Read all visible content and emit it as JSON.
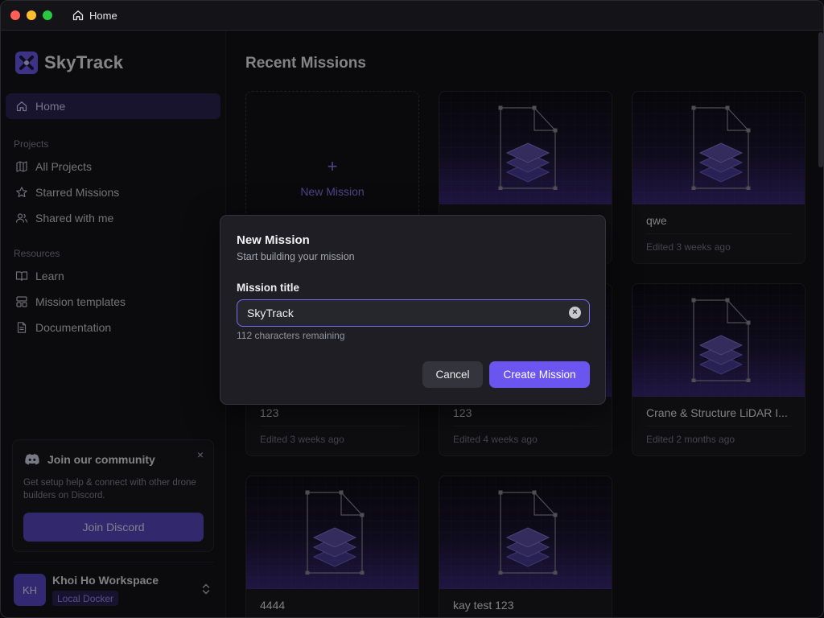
{
  "titlebar": {
    "tab_label": "Home"
  },
  "sidebar": {
    "app_name": "SkyTrack",
    "home_label": "Home",
    "projects_heading": "Projects",
    "projects_items": [
      {
        "label": "All Projects",
        "icon": "map-icon"
      },
      {
        "label": "Starred Missions",
        "icon": "star-icon"
      },
      {
        "label": "Shared with me",
        "icon": "users-icon"
      }
    ],
    "resources_heading": "Resources",
    "resources_items": [
      {
        "label": "Learn",
        "icon": "book-icon"
      },
      {
        "label": "Mission templates",
        "icon": "templates-icon"
      },
      {
        "label": "Documentation",
        "icon": "document-icon"
      }
    ],
    "community": {
      "title": "Join our community",
      "text": "Get setup help & connect with other drone builders on Discord.",
      "button": "Join Discord",
      "close": "×"
    },
    "workspace": {
      "initials": "KH",
      "name": "Khoi Ho Workspace",
      "badge": "Local Docker"
    }
  },
  "main": {
    "title": "Recent Missions",
    "new_mission_label": "New Mission",
    "new_mission_plus": "+",
    "missions": [
      {
        "name": "",
        "edited": ""
      },
      {
        "name": "qwe",
        "edited": "Edited 3 weeks ago"
      },
      {
        "name": "123",
        "edited": "Edited 3 weeks ago"
      },
      {
        "name": "123",
        "edited": "Edited 4 weeks ago"
      },
      {
        "name": "Crane & Structure LiDAR I...",
        "edited": "Edited 2 months ago"
      },
      {
        "name": "4444",
        "edited": ""
      },
      {
        "name": "kay test 123",
        "edited": ""
      }
    ]
  },
  "modal": {
    "title": "New Mission",
    "subtitle": "Start building your mission",
    "field_label": "Mission title",
    "field_value": "SkyTrack",
    "hint": "112 characters remaining",
    "cancel": "Cancel",
    "create": "Create Mission"
  },
  "colors": {
    "accent": "#6b55f0",
    "background": "#131317",
    "sidebar_active": "#2d2654"
  }
}
